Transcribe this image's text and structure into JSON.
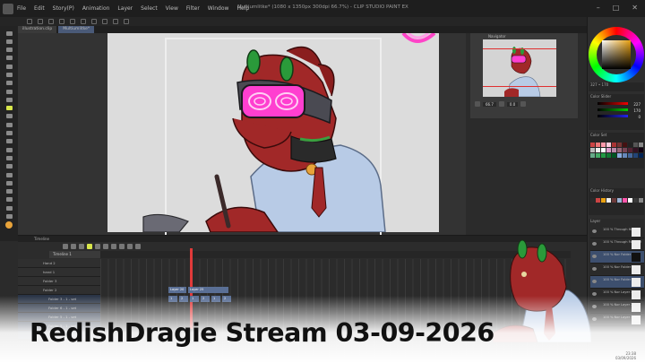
{
  "window": {
    "title": "Multiumlitke* (1080 x 1350px 300dpi 66.7%) - CLIP STUDIO PAINT EX",
    "menu": [
      "File",
      "Edit",
      "Story(P)",
      "Animation",
      "Layer",
      "Select",
      "View",
      "Filter",
      "Window",
      "Help"
    ]
  },
  "tabs": [
    "illustration.clip",
    "Multiumlitke*"
  ],
  "navigator": {
    "header": "Navigator",
    "zoom": "66.7",
    "rotate": "0.0"
  },
  "color_panel": {
    "header": "Color",
    "rgb": {
      "r": "227",
      "g": "170",
      "b": "0"
    },
    "readout": "327 • 170",
    "slider_header": "Color Slider",
    "set_header": "Color Set",
    "history_header": "Color History",
    "swatches": [
      "#c44",
      "#e77",
      "#f9a",
      "#fcd",
      "#a33",
      "#733",
      "#411",
      "#222",
      "#555",
      "#888",
      "#bbb",
      "#eee",
      "#fff",
      "#d9c",
      "#b8a",
      "#967",
      "#745",
      "#523",
      "#312",
      "#101",
      "#6a8",
      "#4a6",
      "#294",
      "#173",
      "#052",
      "#8ad",
      "#68b",
      "#469",
      "#247",
      "#025"
    ],
    "history": [
      "#2a2a2a",
      "#c44",
      "#e8a010",
      "#f0f0f0",
      "#6b3a3a",
      "#9bb3d4",
      "#ff55aa",
      "#ffffff",
      "#3a3a3a",
      "#888"
    ]
  },
  "layers": {
    "header": "Layer",
    "items": [
      {
        "label": "100 % Through Hand 1",
        "selected": false,
        "dark": false
      },
      {
        "label": "100 % Through Folder 2",
        "selected": false,
        "dark": false
      },
      {
        "label": "100 % Nor Folder 6 - 1",
        "selected": true,
        "dark": true
      },
      {
        "label": "100 % Nor Folder 6 - 2",
        "selected": false,
        "dark": false
      },
      {
        "label": "100 % Nor Folder 5 - 1",
        "selected": true,
        "dark": false
      },
      {
        "label": "100 % Nor Layer 25",
        "selected": false,
        "dark": false
      },
      {
        "label": "100 % Nor Layer 21",
        "selected": false,
        "dark": false
      },
      {
        "label": "100 % Nor Layer 20",
        "selected": false,
        "dark": false
      }
    ]
  },
  "timeline": {
    "header": "Timeline",
    "name": "Timeline 1",
    "tracks": [
      {
        "label": "Hand 2",
        "sub": false
      },
      {
        "label": "hand 1",
        "sub": false
      },
      {
        "label": "Folder 3",
        "sub": false
      },
      {
        "label": "Folder 2",
        "sub": false
      },
      {
        "label": "Folder 3 - 1 - set",
        "sub": true
      },
      {
        "label": "Folder 6 - 1 - set",
        "sub": true
      },
      {
        "label": "Folder 5 - 1 - set",
        "sub": true
      },
      {
        "label": "Folder 5 - 1 - set",
        "sub": true
      },
      {
        "label": "Folder 3 - 1 - set",
        "sub": true
      }
    ],
    "cels": [
      "Layer 20",
      "Layer 25",
      "1",
      "2",
      "1",
      "2",
      "1",
      "2"
    ]
  },
  "overlay": {
    "stream_title": "RedishDragie Stream 03-09-2026"
  },
  "clock": {
    "time": "23:38",
    "date": "03/09/2026"
  }
}
